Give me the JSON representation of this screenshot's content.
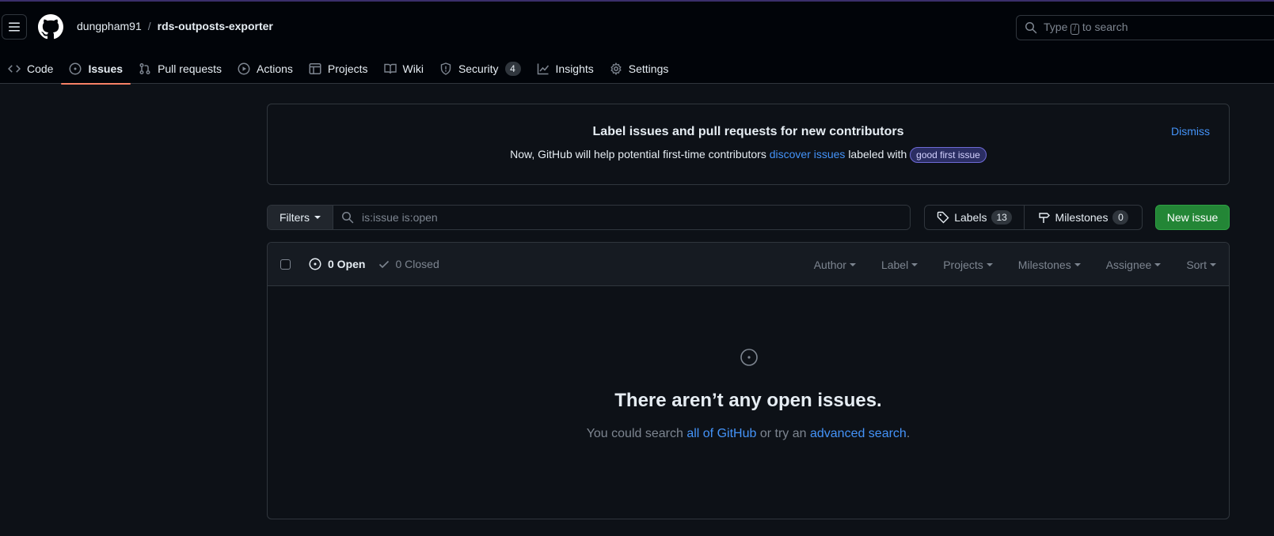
{
  "header": {
    "menu_icon": "three-bars-icon",
    "logo_icon": "github-mark-icon",
    "owner": "dungpham91",
    "separator": "/",
    "repo": "rds-outposts-exporter",
    "search": {
      "prefix": "Type",
      "key": "/",
      "suffix": "to search",
      "icon": "search-icon"
    }
  },
  "nav": {
    "code": "Code",
    "issues": "Issues",
    "pulls": "Pull requests",
    "actions": "Actions",
    "projects": "Projects",
    "wiki": "Wiki",
    "security": "Security",
    "security_count": "4",
    "insights": "Insights",
    "settings": "Settings",
    "selected": "issues"
  },
  "banner": {
    "title": "Label issues and pull requests for new contributors",
    "text_before": "Now, GitHub will help potential first-time contributors",
    "link": "discover issues",
    "text_after": "labeled with",
    "label": "good first issue",
    "dismiss": "Dismiss"
  },
  "toolbar": {
    "filters": "Filters",
    "query": "is:issue is:open",
    "labels": "Labels",
    "labels_count": "13",
    "milestones": "Milestones",
    "milestones_count": "0",
    "new_issue": "New issue"
  },
  "list": {
    "open": "0 Open",
    "closed": "0 Closed",
    "sorts": [
      "Author",
      "Label",
      "Projects",
      "Milestones",
      "Assignee",
      "Sort"
    ]
  },
  "blankslate": {
    "title": "There aren’t any open issues.",
    "text_1": "You could search",
    "link_1": "all of GitHub",
    "text_2": "or try an",
    "link_2": "advanced search",
    "text_3": "."
  },
  "colors": {
    "background": "#0d1117",
    "header_bg": "#010409",
    "accent_tab": "#f78166",
    "link": "#4493f8",
    "primary_button": "#238636"
  }
}
